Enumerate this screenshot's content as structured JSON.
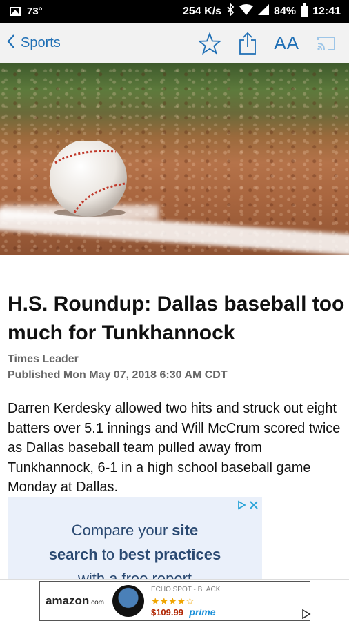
{
  "status_bar": {
    "temperature": "73°",
    "network_speed": "254 K/s",
    "battery": "84%",
    "time": "12:41"
  },
  "toolbar": {
    "back_label": "Sports",
    "font_size_label": "AA"
  },
  "article": {
    "headline": "H.S. Roundup: Dallas baseball too much for Tunkhannock",
    "source": "Times Leader",
    "published": "Published Mon May 07, 2018 6:30 AM CDT",
    "body": "Darren Kerdesky allowed two hits and struck out eight batters over 5.1 innings and Will McCrum scored twice as Dallas baseball team pulled away from Tunkhannock, 6-1 in a high school baseball game Monday at Dallas."
  },
  "ad": {
    "line1_a": "Compare your ",
    "line1_b": "site",
    "line2_a": "search",
    "line2_b": " to ",
    "line2_c": "best practices",
    "line3": "with a free report"
  },
  "banner": {
    "brand": "amazon",
    "brand_suffix": ".com",
    "product": "ECHO SPOT - BLACK",
    "stars": "★★★★☆",
    "price": "$109.99",
    "prime": "prime"
  },
  "colors": {
    "accent": "#1f6fb5",
    "ad_background": "#eaf0fa",
    "ad_text": "#2b4a72"
  }
}
